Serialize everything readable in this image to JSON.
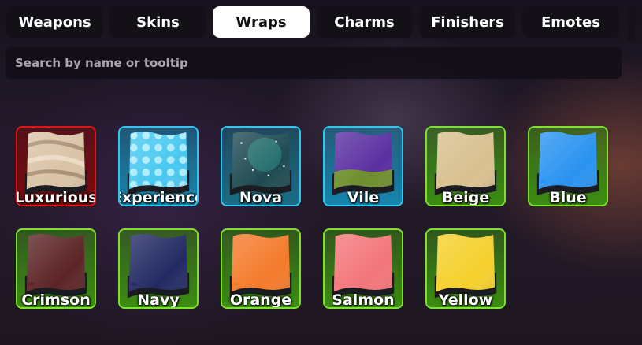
{
  "tabs": [
    {
      "label": "Weapons",
      "active": false
    },
    {
      "label": "Skins",
      "active": false
    },
    {
      "label": "Wraps",
      "active": true
    },
    {
      "label": "Charms",
      "active": false
    },
    {
      "label": "Finishers",
      "active": false
    },
    {
      "label": "Emotes",
      "active": false
    }
  ],
  "search": {
    "placeholder": "Search by name or tooltip",
    "value": ""
  },
  "wraps": [
    {
      "name": "Luxurious",
      "rarity_color": "#e11414",
      "bg": "#7a0a0a",
      "fill": "#d9c3a6",
      "pattern": "swirl"
    },
    {
      "name": "Experience",
      "rarity_color": "#2fc6ef",
      "bg": "#1786ad",
      "fill": "#49c8f0",
      "pattern": "stars"
    },
    {
      "name": "Nova",
      "rarity_color": "#2fc6ef",
      "bg": "#1a6e86",
      "fill": "#1f4a52",
      "pattern": "space"
    },
    {
      "name": "Vile",
      "rarity_color": "#2fc6ef",
      "bg": "#1786ad",
      "fill": "#5a2fa1",
      "pattern": "vile"
    },
    {
      "name": "Beige",
      "rarity_color": "#7de22e",
      "bg": "#3c8d12",
      "fill": "#d8c08f",
      "pattern": "solid"
    },
    {
      "name": "Blue",
      "rarity_color": "#7de22e",
      "bg": "#3c8d12",
      "fill": "#2a93f0",
      "pattern": "solid"
    },
    {
      "name": "Crimson",
      "rarity_color": "#7de22e",
      "bg": "#3c8d12",
      "fill": "#5c2427",
      "pattern": "solid"
    },
    {
      "name": "Navy",
      "rarity_color": "#7de22e",
      "bg": "#3c8d12",
      "fill": "#232a63",
      "pattern": "solid"
    },
    {
      "name": "Orange",
      "rarity_color": "#7de22e",
      "bg": "#3c8d12",
      "fill": "#f47a2b",
      "pattern": "solid"
    },
    {
      "name": "Salmon",
      "rarity_color": "#7de22e",
      "bg": "#3c8d12",
      "fill": "#f3767a",
      "pattern": "solid"
    },
    {
      "name": "Yellow",
      "rarity_color": "#7de22e",
      "bg": "#3c8d12",
      "fill": "#f5d02c",
      "pattern": "solid"
    }
  ]
}
